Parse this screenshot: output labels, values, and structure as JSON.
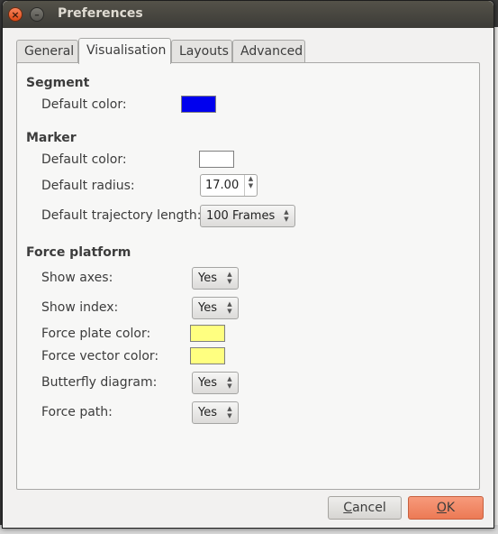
{
  "window": {
    "title": "Preferences"
  },
  "tabs": [
    {
      "label": "General"
    },
    {
      "label": "Visualisation"
    },
    {
      "label": "Layouts"
    },
    {
      "label": "Advanced"
    }
  ],
  "segment": {
    "heading": "Segment",
    "default_color_label": "Default color:",
    "default_color": "#0000ee"
  },
  "marker": {
    "heading": "Marker",
    "default_color_label": "Default color:",
    "default_color": "#ffffff",
    "default_radius_label": "Default radius:",
    "default_radius": "17.00",
    "trajectory_label": "Default trajectory length:",
    "trajectory_value": "100 Frames"
  },
  "force_platform": {
    "heading": "Force platform",
    "show_axes_label": "Show axes:",
    "show_axes": "Yes",
    "show_index_label": "Show index:",
    "show_index": "Yes",
    "plate_color_label": "Force plate color:",
    "plate_color": "#ffff80",
    "vector_color_label": "Force vector color:",
    "vector_color": "#ffff80",
    "butterfly_label": "Butterfly diagram:",
    "butterfly": "Yes",
    "path_label": "Force path:",
    "path": "Yes"
  },
  "buttons": {
    "cancel_first": "C",
    "cancel_rest": "ancel",
    "ok_first": "O",
    "ok_rest": "K"
  }
}
